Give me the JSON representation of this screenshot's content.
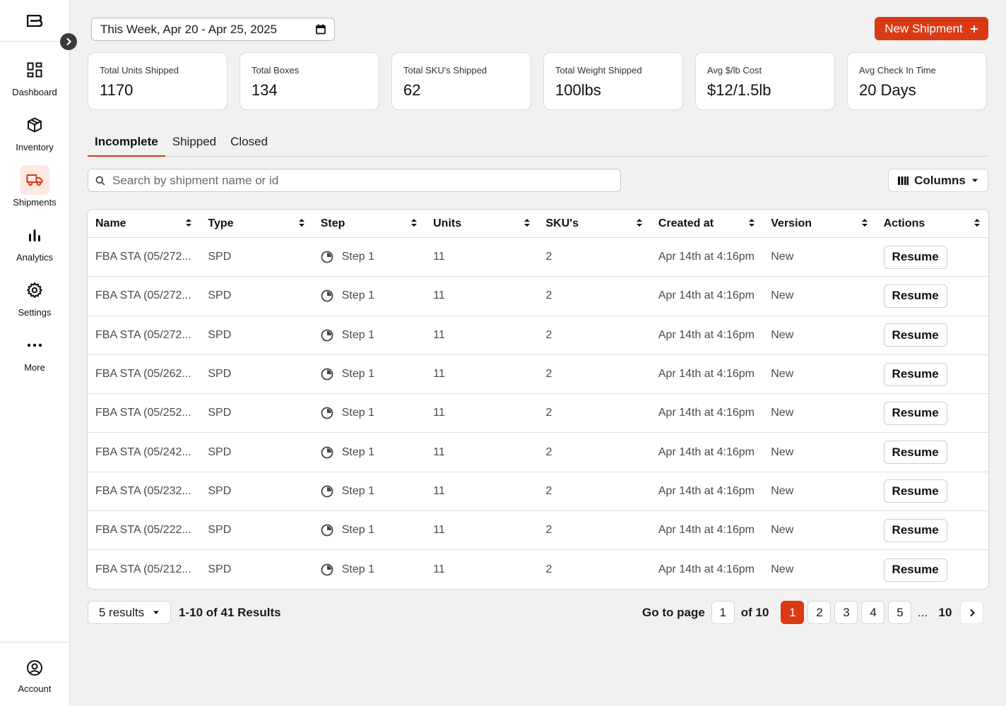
{
  "colors": {
    "accent": "#d93a14",
    "active_nav_bg": "#fde9e4"
  },
  "sidebar": {
    "items": [
      {
        "label": "Dashboard",
        "icon": "dashboard-icon"
      },
      {
        "label": "Inventory",
        "icon": "box-icon"
      },
      {
        "label": "Shipments",
        "icon": "truck-icon",
        "active": true
      },
      {
        "label": "Analytics",
        "icon": "bar-chart-icon"
      },
      {
        "label": "Settings",
        "icon": "gear-icon"
      },
      {
        "label": "More",
        "icon": "more-icon"
      }
    ],
    "account_label": "Account"
  },
  "header": {
    "date_range": "This Week, Apr 20 - Apr 25, 2025",
    "new_shipment_label": "New Shipment",
    "new_shipment_icon": "plus-icon"
  },
  "stats": [
    {
      "label": "Total Units Shipped",
      "value": "1170"
    },
    {
      "label": "Total Boxes",
      "value": "134"
    },
    {
      "label": "Total SKU's Shipped",
      "value": "62"
    },
    {
      "label": "Total Weight Shipped",
      "value": "100lbs"
    },
    {
      "label": "Avg $/lb Cost",
      "value": "$12/1.5lb"
    },
    {
      "label": "Avg Check In Time",
      "value": "20 Days"
    }
  ],
  "tabs": [
    {
      "label": "Incomplete",
      "active": true
    },
    {
      "label": "Shipped"
    },
    {
      "label": "Closed"
    }
  ],
  "search": {
    "placeholder": "Search by shipment name or id",
    "value": ""
  },
  "columns_button": {
    "label": "Columns"
  },
  "table": {
    "headers": [
      "Name",
      "Type",
      "Step",
      "Units",
      "SKU's",
      "Created at",
      "Version",
      "Actions"
    ],
    "rows": [
      {
        "name": "FBA STA (05/272...",
        "type": "SPD",
        "step": "Step 1",
        "units": "11",
        "skus": "2",
        "created": "Apr 14th at 4:16pm",
        "version": "New",
        "action": "Resume"
      },
      {
        "name": "FBA STA (05/272...",
        "type": "SPD",
        "step": "Step 1",
        "units": "11",
        "skus": "2",
        "created": "Apr 14th at 4:16pm",
        "version": "New",
        "action": "Resume"
      },
      {
        "name": "FBA STA (05/272...",
        "type": "SPD",
        "step": "Step 1",
        "units": "11",
        "skus": "2",
        "created": "Apr 14th at 4:16pm",
        "version": "New",
        "action": "Resume"
      },
      {
        "name": "FBA STA (05/262...",
        "type": "SPD",
        "step": "Step 1",
        "units": "11",
        "skus": "2",
        "created": "Apr 14th at 4:16pm",
        "version": "New",
        "action": "Resume"
      },
      {
        "name": "FBA STA (05/252...",
        "type": "SPD",
        "step": "Step 1",
        "units": "11",
        "skus": "2",
        "created": "Apr 14th at 4:16pm",
        "version": "New",
        "action": "Resume"
      },
      {
        "name": "FBA STA (05/242...",
        "type": "SPD",
        "step": "Step 1",
        "units": "11",
        "skus": "2",
        "created": "Apr 14th at 4:16pm",
        "version": "New",
        "action": "Resume"
      },
      {
        "name": "FBA STA (05/232...",
        "type": "SPD",
        "step": "Step 1",
        "units": "11",
        "skus": "2",
        "created": "Apr 14th at 4:16pm",
        "version": "New",
        "action": "Resume"
      },
      {
        "name": "FBA STA (05/222...",
        "type": "SPD",
        "step": "Step 1",
        "units": "11",
        "skus": "2",
        "created": "Apr 14th at 4:16pm",
        "version": "New",
        "action": "Resume"
      },
      {
        "name": "FBA STA (05/212...",
        "type": "SPD",
        "step": "Step 1",
        "units": "11",
        "skus": "2",
        "created": "Apr 14th at 4:16pm",
        "version": "New",
        "action": "Resume"
      }
    ]
  },
  "footer": {
    "per_page": "5 results",
    "results_text": "1-10 of 41 Results",
    "go_to_page_label": "Go to page",
    "go_to_page_value": "1",
    "of_pages": "of 10",
    "pages": [
      "1",
      "2",
      "3",
      "4",
      "5"
    ],
    "current_page": "1",
    "ellipsis": "...",
    "last_page": "10"
  }
}
